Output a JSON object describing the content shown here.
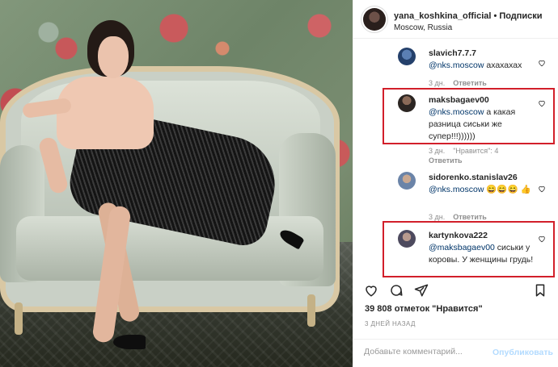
{
  "post_header": {
    "username": "yana_koshkina_official",
    "separator": "•",
    "follow_label": "Подписки",
    "location": "Moscow, Russia"
  },
  "comments": [
    {
      "username": "slavich7.7.7",
      "mention": "@nks.moscow",
      "text": " ахахахах",
      "time": "3 дн.",
      "likes": "",
      "reply_label": "Ответить"
    },
    {
      "username": "maksbagaev00",
      "mention": "@nks.moscow",
      "text": " а какая разница сиськи же супер!!!))))))",
      "time": "3 дн.",
      "likes": "\"Нравится\": 4",
      "reply_label": "Ответить"
    },
    {
      "username": "sidorenko.stanislav26",
      "mention": "@nks.moscow",
      "text": " 😄😄😄 👍",
      "time": "3 дн.",
      "likes": "",
      "reply_label": "Ответить"
    },
    {
      "username": "kartynkova222",
      "mention": "@maksbagaev00",
      "text": " сиськи у коровы. У женщины грудь!",
      "time": "",
      "likes": "",
      "reply_label": ""
    }
  ],
  "actions": {
    "like_icon": "heart-outline-icon",
    "comment_icon": "comment-bubble-icon",
    "share_icon": "paper-plane-icon",
    "save_icon": "bookmark-icon"
  },
  "likes_text": "39 808 отметок \"Нравится\"",
  "posted_time": "3 ДНЕЙ НАЗАД",
  "add_comment": {
    "placeholder": "Добавьте комментарий...",
    "publish_label": "Опубликовать"
  },
  "colors": {
    "highlight_border": "#d21f2a",
    "publish_disabled": "#b3dbff",
    "meta_gray": "#8e8e8e",
    "mention_blue": "#003569"
  }
}
